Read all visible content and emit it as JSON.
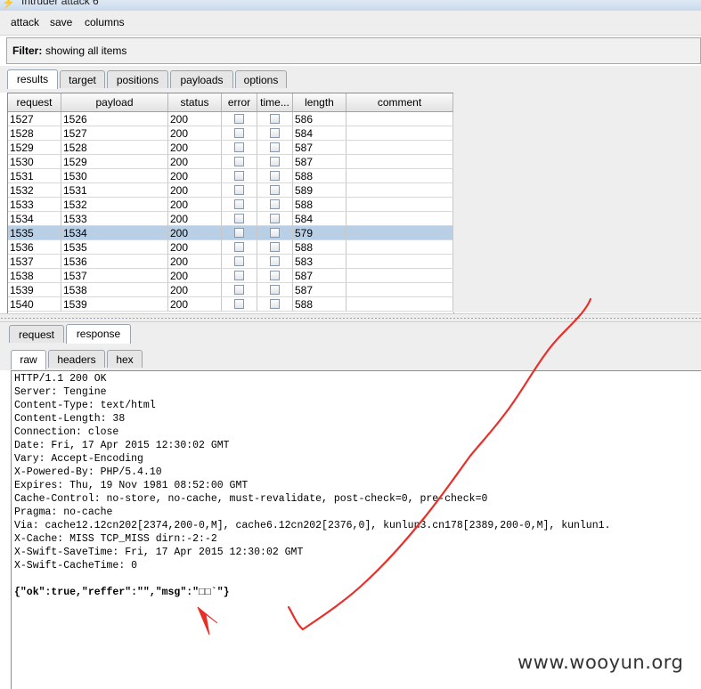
{
  "window": {
    "title": "Intruder attack 6"
  },
  "menu": {
    "items": [
      "attack",
      "save",
      "columns"
    ]
  },
  "filter": {
    "label": "Filter:",
    "text": "showing all items"
  },
  "main_tabs": [
    "results",
    "target",
    "positions",
    "payloads",
    "options"
  ],
  "table": {
    "columns": [
      "request",
      "payload",
      "status",
      "error",
      "time...",
      "length",
      "comment"
    ],
    "selected_request": "1535",
    "rows": [
      {
        "request": "1527",
        "payload": "1526",
        "status": "200",
        "length": "586"
      },
      {
        "request": "1528",
        "payload": "1527",
        "status": "200",
        "length": "584"
      },
      {
        "request": "1529",
        "payload": "1528",
        "status": "200",
        "length": "587"
      },
      {
        "request": "1530",
        "payload": "1529",
        "status": "200",
        "length": "587"
      },
      {
        "request": "1531",
        "payload": "1530",
        "status": "200",
        "length": "588"
      },
      {
        "request": "1532",
        "payload": "1531",
        "status": "200",
        "length": "589"
      },
      {
        "request": "1533",
        "payload": "1532",
        "status": "200",
        "length": "588"
      },
      {
        "request": "1534",
        "payload": "1533",
        "status": "200",
        "length": "584"
      },
      {
        "request": "1535",
        "payload": "1534",
        "status": "200",
        "length": "579"
      },
      {
        "request": "1536",
        "payload": "1535",
        "status": "200",
        "length": "588"
      },
      {
        "request": "1537",
        "payload": "1536",
        "status": "200",
        "length": "583"
      },
      {
        "request": "1538",
        "payload": "1537",
        "status": "200",
        "length": "587"
      },
      {
        "request": "1539",
        "payload": "1538",
        "status": "200",
        "length": "587"
      },
      {
        "request": "1540",
        "payload": "1539",
        "status": "200",
        "length": "588"
      }
    ]
  },
  "reqresp_tabs": [
    "request",
    "response"
  ],
  "view_tabs": [
    "raw",
    "headers",
    "hex"
  ],
  "response": {
    "lines": [
      "HTTP/1.1 200 OK",
      "Server: Tengine",
      "Content-Type: text/html",
      "Content-Length: 38",
      "Connection: close",
      "Date: Fri, 17 Apr 2015 12:30:02 GMT",
      "Vary: Accept-Encoding",
      "X-Powered-By: PHP/5.4.10",
      "Expires: Thu, 19 Nov 1981 08:52:00 GMT",
      "Cache-Control: no-store, no-cache, must-revalidate, post-check=0, pre-check=0",
      "Pragma: no-cache",
      "Via: cache12.12cn202[2374,200-0,M], cache6.12cn202[2376,0], kunlun3.cn178[2389,200-0,M], kunlun1.",
      "X-Cache: MISS TCP_MISS dirn:-2:-2",
      "X-Swift-SaveTime: Fri, 17 Apr 2015 12:30:02 GMT",
      "X-Swift-CacheTime: 0"
    ],
    "body": "{\"ok\":true,\"reffer\":\"\",\"msg\":\"□□`\"}"
  },
  "watermark": "www.wooyun.org",
  "colors": {
    "selected_row": "#b8cfe5",
    "annotation": "#e8302a"
  }
}
